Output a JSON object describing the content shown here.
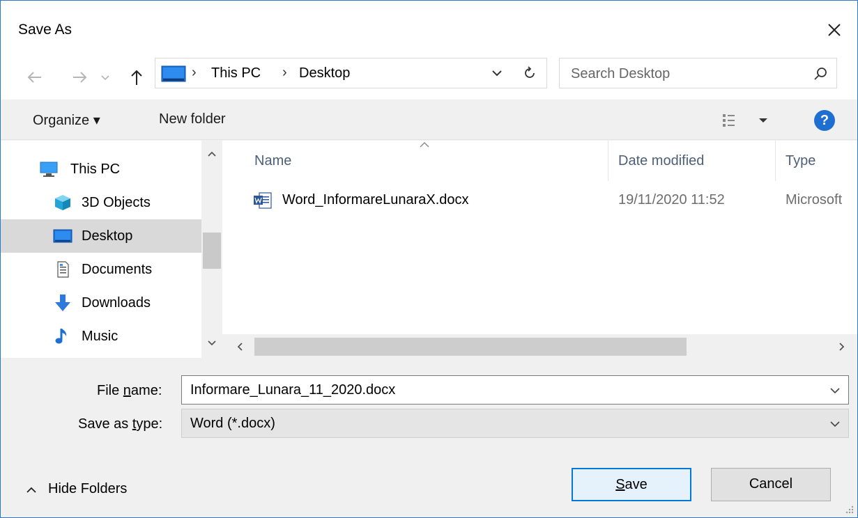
{
  "window": {
    "title": "Save As"
  },
  "navigation": {
    "back_icon": "arrow-left",
    "forward_icon": "arrow-right",
    "recent_icon": "chevron-down",
    "up_icon": "arrow-up"
  },
  "address": {
    "breadcrumbs": [
      "This PC",
      "Desktop"
    ],
    "separator": "›"
  },
  "search": {
    "placeholder": "Search Desktop"
  },
  "command_bar": {
    "organize_label": "Organize ▾",
    "new_folder_label": "New folder",
    "view_icon": "details-view",
    "help_label": "?"
  },
  "nav_pane": {
    "items": [
      {
        "label": "This PC",
        "icon": "computer",
        "selected": false
      },
      {
        "label": "3D Objects",
        "icon": "cube",
        "selected": false
      },
      {
        "label": "Desktop",
        "icon": "desktop",
        "selected": true
      },
      {
        "label": "Documents",
        "icon": "document",
        "selected": false
      },
      {
        "label": "Downloads",
        "icon": "download-arrow",
        "selected": false
      },
      {
        "label": "Music",
        "icon": "music-note",
        "selected": false
      }
    ]
  },
  "file_list": {
    "columns": [
      "Name",
      "Date modified",
      "Type"
    ],
    "rows": [
      {
        "name": "Word_InformareLunaraX.docx",
        "date": "19/11/2020 11:52",
        "type": "Microsoft",
        "icon": "word-document"
      }
    ]
  },
  "form": {
    "file_name_label_pre": "File ",
    "file_name_label_u": "n",
    "file_name_label_post": "ame:",
    "file_name_value": "Informare_Lunara_11_2020.docx",
    "save_type_label_pre": "Save as ",
    "save_type_label_u": "t",
    "save_type_label_post": "ype:",
    "save_type_value": "Word (*.docx)"
  },
  "footer": {
    "hide_folders_label": "Hide Folders",
    "save_u": "S",
    "save_rest": "ave",
    "cancel_label": "Cancel"
  },
  "colors": {
    "accent": "#0078d7",
    "selection": "#d9d9d9",
    "header_text": "#4c607a"
  }
}
